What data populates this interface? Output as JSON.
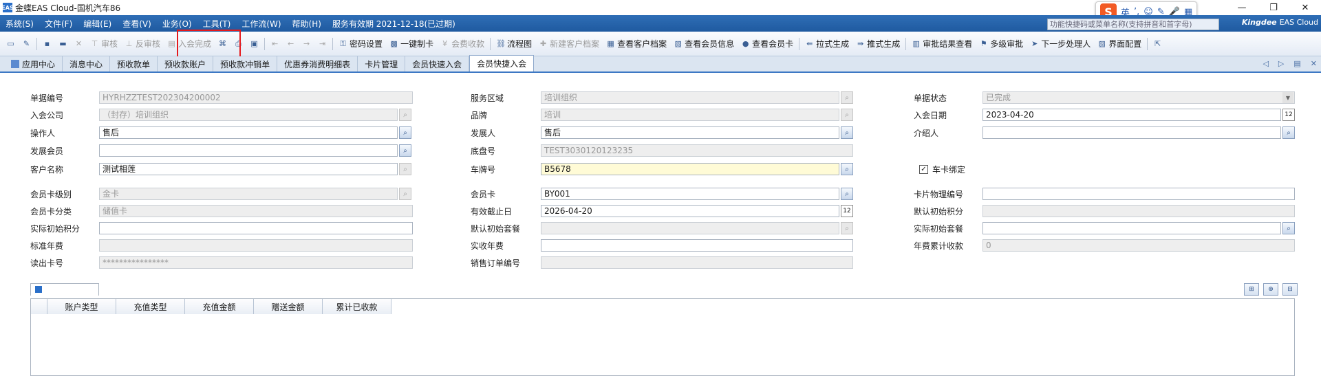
{
  "window": {
    "title": "金蝶EAS Cloud-国机汽车86",
    "minimize": "—",
    "restore": "❐",
    "close": "✕"
  },
  "ime": {
    "logo": "S",
    "lang": "英",
    "punct": "’,",
    "emoji": "☺",
    "pen": "✎",
    "mic": "🎤",
    "grid": "▦"
  },
  "menubar": {
    "items": [
      "系统(S)",
      "文件(F)",
      "编辑(E)",
      "查看(V)",
      "业务(O)",
      "工具(T)",
      "工作流(W)",
      "帮助(H)"
    ],
    "service_period": "服务有效期 2021-12-18(已过期)",
    "search_placeholder": "功能快捷码或菜单名称(支持拼音和首字母)",
    "brand": "Kingdee",
    "brand_product": "EAS Cloud"
  },
  "toolbar": {
    "items": [
      {
        "label": "",
        "icon": "new-icon",
        "enabled": true
      },
      {
        "label": "",
        "icon": "edit-icon",
        "enabled": true
      },
      {
        "label": "",
        "icon": "save-icon",
        "enabled": true
      },
      {
        "label": "",
        "icon": "submit-icon",
        "enabled": true
      },
      {
        "label": "",
        "icon": "delete-icon",
        "enabled": false
      },
      {
        "label": "审核",
        "icon": "audit-icon",
        "enabled": false
      },
      {
        "label": "反审核",
        "icon": "unaudit-icon",
        "enabled": false
      },
      {
        "label": "入会完成",
        "icon": "join-complete-icon",
        "enabled": false
      },
      {
        "label": "",
        "icon": "attachment-icon",
        "enabled": true
      },
      {
        "label": "",
        "icon": "print-icon",
        "enabled": true
      },
      {
        "label": "",
        "icon": "print-preview-icon",
        "enabled": true
      },
      {
        "label": "",
        "icon": "first-icon",
        "enabled": false
      },
      {
        "label": "",
        "icon": "prev-icon",
        "enabled": false
      },
      {
        "label": "",
        "icon": "next-icon",
        "enabled": false
      },
      {
        "label": "",
        "icon": "last-icon",
        "enabled": false
      },
      {
        "label": "密码设置",
        "icon": "password-icon",
        "enabled": true
      },
      {
        "label": "一键制卡",
        "icon": "make-card-icon",
        "enabled": true
      },
      {
        "label": "会费收款",
        "icon": "fee-icon",
        "enabled": false
      },
      {
        "label": "流程图",
        "icon": "flowchart-icon",
        "enabled": true
      },
      {
        "label": "新建客户档案",
        "icon": "new-customer-icon",
        "enabled": false
      },
      {
        "label": "查看客户档案",
        "icon": "view-customer-icon",
        "enabled": true
      },
      {
        "label": "查看会员信息",
        "icon": "view-member-icon",
        "enabled": true
      },
      {
        "label": "查看会员卡",
        "icon": "view-card-icon",
        "enabled": true
      },
      {
        "label": "拉式生成",
        "icon": "pull-generate-icon",
        "enabled": true
      },
      {
        "label": "推式生成",
        "icon": "push-generate-icon",
        "enabled": true
      },
      {
        "label": "审批结果查看",
        "icon": "approval-result-icon",
        "enabled": true
      },
      {
        "label": "多级审批",
        "icon": "multi-approval-icon",
        "enabled": true
      },
      {
        "label": "下一步处理人",
        "icon": "next-handler-icon",
        "enabled": true
      },
      {
        "label": "界面配置",
        "icon": "ui-config-icon",
        "enabled": true
      },
      {
        "label": "",
        "icon": "export-icon",
        "enabled": true
      }
    ]
  },
  "tabs": [
    {
      "label": "应用中心",
      "active": false
    },
    {
      "label": "消息中心",
      "active": false
    },
    {
      "label": "预收款单",
      "active": false
    },
    {
      "label": "预收款账户",
      "active": false
    },
    {
      "label": "预收款冲销单",
      "active": false
    },
    {
      "label": "优惠券消费明细表",
      "active": false
    },
    {
      "label": "卡片管理",
      "active": false
    },
    {
      "label": "会员快速入会",
      "active": false
    },
    {
      "label": "会员快捷入会",
      "active": true
    }
  ],
  "form": {
    "bill_no": {
      "label": "单据编号",
      "value": "HYRHZZTEST202304200002"
    },
    "join_company": {
      "label": "入会公司",
      "value": "（封存）培训组织"
    },
    "operator": {
      "label": "操作人",
      "value": "售后"
    },
    "dev_member": {
      "label": "发展会员",
      "value": ""
    },
    "customer_name": {
      "label": "客户名称",
      "value": "测试相莲"
    },
    "card_level": {
      "label": "会员卡级别",
      "value": "金卡"
    },
    "card_category": {
      "label": "会员卡分类",
      "value": "储值卡"
    },
    "actual_init_points": {
      "label": "实际初始积分",
      "value": ""
    },
    "standard_annual_fee": {
      "label": "标准年费",
      "value": ""
    },
    "read_card_no": {
      "label": "读出卡号",
      "value": "****************"
    },
    "service_area": {
      "label": "服务区域",
      "value": "培训组织"
    },
    "brand": {
      "label": "品牌",
      "value": "培训"
    },
    "developer": {
      "label": "发展人",
      "value": "售后"
    },
    "chassis_no": {
      "label": "底盘号",
      "value": "TEST3030120123235"
    },
    "plate_no": {
      "label": "车牌号",
      "value": "B5678"
    },
    "member_card": {
      "label": "会员卡",
      "value": "BY001"
    },
    "expiry_date": {
      "label": "有效截止日",
      "value": "2026-04-20"
    },
    "default_init_package": {
      "label": "默认初始套餐",
      "value": ""
    },
    "actual_annual_fee": {
      "label": "实收年费",
      "value": ""
    },
    "sales_order_no": {
      "label": "销售订单编号",
      "value": ""
    },
    "bill_status": {
      "label": "单据状态",
      "value": "已完成"
    },
    "join_date": {
      "label": "入会日期",
      "value": "2023-04-20"
    },
    "introducer": {
      "label": "介绍人",
      "value": ""
    },
    "card_binding": {
      "label": "车卡绑定",
      "checked": true
    },
    "card_physical_no": {
      "label": "卡片物理编号",
      "value": ""
    },
    "default_init_points": {
      "label": "默认初始积分",
      "value": ""
    },
    "actual_init_package": {
      "label": "实际初始套餐",
      "value": ""
    },
    "annual_fee_total": {
      "label": "年费累计收款",
      "value": "0"
    }
  },
  "grid": {
    "columns": [
      "",
      "账户类型",
      "充值类型",
      "充值金额",
      "赠送金额",
      "累计已收款"
    ]
  }
}
